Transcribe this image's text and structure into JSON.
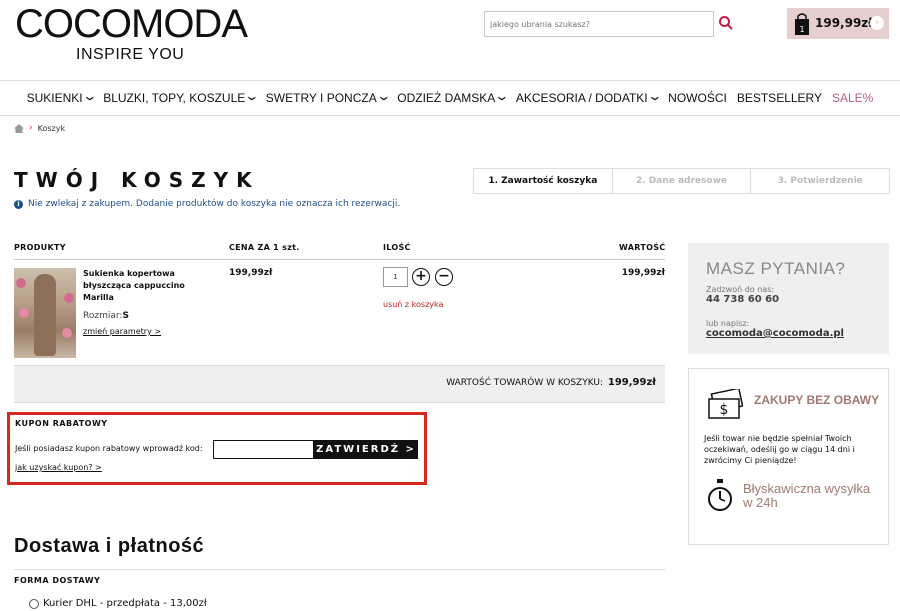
{
  "header": {
    "logo_text": "COCOMODA",
    "tagline": "INSPIRE YOU",
    "search_placeholder": "jakiego ubrania szukasz?",
    "cart_count": "1",
    "cart_amount": "199,99zł"
  },
  "nav": {
    "items": [
      {
        "label": "SUKIENKI",
        "dropdown": true
      },
      {
        "label": "BLUZKI, TOPY, KOSZULE",
        "dropdown": true
      },
      {
        "label": "SWETRY I PONCZA",
        "dropdown": true
      },
      {
        "label": "ODZIEŻ DAMSKA",
        "dropdown": true
      },
      {
        "label": "AKCESORIA / DODATKI",
        "dropdown": true
      },
      {
        "label": "NOWOŚCI",
        "dropdown": false
      },
      {
        "label": "BESTSELLERY",
        "dropdown": false
      },
      {
        "label": "SALE%",
        "dropdown": false
      }
    ],
    "sale_color": "#b0637a"
  },
  "breadcrumb": {
    "current": "Koszyk"
  },
  "page": {
    "title": "TWÓJ KOSZYK",
    "info": "Nie zwlekaj z zakupem. Dodanie produktów do koszyka nie oznacza ich rezerwacji."
  },
  "steps": [
    "1. Zawartość koszyka",
    "2. Dane adresowe",
    "3. Potwierdzenie"
  ],
  "table": {
    "headers": {
      "product": "PRODUKTY",
      "price": "CENA ZA 1 szt.",
      "qty": "ILOŚĆ",
      "value": "WARTOŚĆ"
    },
    "item": {
      "name": "Sukienka kopertowa błyszcząca cappuccino Marilla",
      "size_label": "Rozmiar:",
      "size": "S",
      "change_link": "zmień parametry >",
      "price": "199,99zł",
      "qty": "1",
      "remove": "usuń z koszyka",
      "total": "199,99zł"
    },
    "summary_label": "WARTOŚĆ TOWARÓW W KOSZYKU:",
    "summary_value": "199,99zł"
  },
  "coupon": {
    "title": "KUPON RABATOWY",
    "hint": "Jeśli posiadasz kupon rabatowy wprowadź kod:",
    "button": "ZATWIERDŹ >",
    "link": "jak uzyskać kupon? >",
    "highlight_color": "#d6281e"
  },
  "delivery": {
    "title": "Dostawa i płatność",
    "subtitle": "FORMA DOSTAWY",
    "option": "Kurier DHL - przedpłata - 13,00zł"
  },
  "sidebar": {
    "faq_title": "MASZ PYTANIA?",
    "call_label": "Zadzwoń do nas:",
    "phone": "44 738 60 60",
    "write_label": "lub napisz:",
    "email": "cocomoda@cocomoda.pl",
    "safe_title": "ZAKUPY BEZ OBAWY",
    "safe_text": "Jeśli towar nie będzie spełniał Twoich oczekiwań, odeślij go w ciągu 14 dni i zwrócimy Ci pieniądze!",
    "fast_title": "Błyskawiczna wysyłka w 24h",
    "accent_color": "#a07a72"
  }
}
